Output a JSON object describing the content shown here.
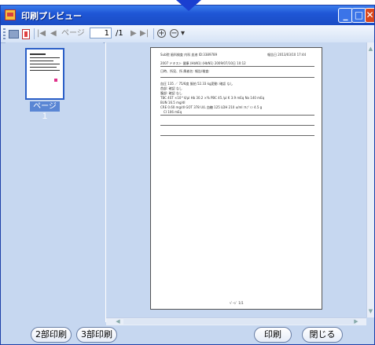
{
  "window": {
    "title": "印刷プレビュー"
  },
  "toolbar": {
    "page_label": "ページ",
    "current_page": "1",
    "total_pages": "/1",
    "zoom_in": "+",
    "zoom_out": "−",
    "dropdown": "▾",
    "nav_first": "|◀",
    "nav_prev": "◀",
    "nav_next": "▶",
    "nav_last": "▶|"
  },
  "thumbnail": {
    "label": "ページ１"
  },
  "document": {
    "header_left": "Sub院 歯科検査 内科 血液 ID:3389789",
    "header_right": "報告日 2013/03/10 17:44",
    "line1": "2007 ドキスト 健康 (HbN1) (HbN1) 2009/07/10日 10:12",
    "line2": "日時、所見、所 属者名: 報告/検査: ",
    "line3": "血圧 135 ／ 75/6度 脈拍 52.33 kg変動: 確認 なし",
    "line4": "首部: 確認 なし",
    "line5": "腹部: 確認 なし",
    "lab1": "TBC 4ST ×10^4/μl     Hb 30.2 ×%     PBC 45 /μl     K 3.9 mEq     Na 140 mEq",
    "lab2": "BUN 16.5 mg/dl",
    "lab3": "CRE 0.60 mg/dl     GOT 378 U/L     血糖 125     LDH 210 u/ml     ｱﾙﾌﾞﾐﾝ 4.5 g",
    "lab4": "CI 106 mEq",
    "footer": "ﾍﾟｰｼﾞ 1/1"
  },
  "buttons": {
    "print2": "2部印刷",
    "print3": "3部印刷",
    "print": "印刷",
    "close": "閉じる"
  }
}
